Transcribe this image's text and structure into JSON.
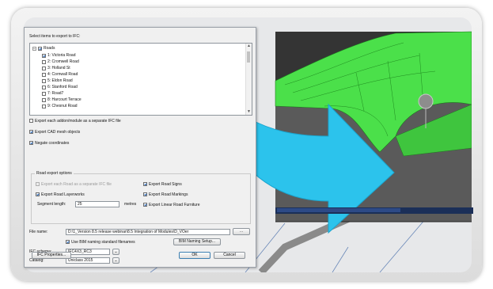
{
  "dialog": {
    "heading": "Select items to export to IFC:",
    "tree": {
      "root_label": "Roads",
      "items": [
        "1: Victoria Road",
        "2: Cromwell Road",
        "3: Holland St",
        "4: Cornwall Road",
        "5: Eldon Road",
        "6: Stanford Road",
        "7: Road7",
        "8: Harcourt Terrace",
        "9: Chesnut Road"
      ]
    },
    "options": {
      "separate_ifc": "Export each addon/module as a separate IFC file",
      "cad_mesh": "Export CAD mesh objects",
      "negate": "Negate coordinates"
    },
    "road_export": {
      "title": "Road export options",
      "each_road_separate": "Export each Road as a separate IFC file",
      "road_signs": "Export Road Signs",
      "road_layerworks": "Export Road Layerworks",
      "road_markings": "Export Road Markings",
      "segment_length_label": "Segment length:",
      "segment_length_value": "25",
      "segment_length_unit": "metres",
      "linear_furniture": "Export Linear Road Furniture"
    },
    "file": {
      "label": "File name:",
      "value": "D:\\1_Version 8.5 release webinar\\8.5 Integration of Modules\\D_VOer"
    },
    "bim_naming_checkbox": "Use BIM naming standard filenames",
    "bim_naming_button": "BIM Naming Setup...",
    "schema": {
      "label": "IFC schema:",
      "value": "IFC4X3_RC3"
    },
    "catalog": {
      "label": "Catalog:",
      "value": "Uniclass 2015"
    },
    "buttons": {
      "properties": "IFC Properties...",
      "ok": "OK",
      "cancel": "Cancel"
    }
  },
  "colors": {
    "arrow": "#2cc3ec",
    "road_surface": "#4be04a",
    "frame": "#e4e4e4"
  }
}
